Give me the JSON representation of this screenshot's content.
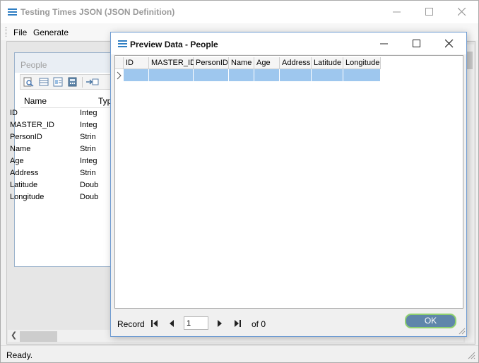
{
  "main_window": {
    "title": "Testing Times JSON (JSON Definition)",
    "menu": [
      "File",
      "Generate"
    ],
    "status": "Ready."
  },
  "people_panel": {
    "title": "People",
    "columns": [
      "Name",
      "Typ"
    ],
    "fields": [
      {
        "name": "ID",
        "type": "Integ"
      },
      {
        "name": "MASTER_ID",
        "type": "Integ"
      },
      {
        "name": "PersonID",
        "type": "Strin"
      },
      {
        "name": "Name",
        "type": "Strin"
      },
      {
        "name": "Age",
        "type": "Integ"
      },
      {
        "name": "Address",
        "type": "Strin"
      },
      {
        "name": "Latitude",
        "type": "Doub"
      },
      {
        "name": "Longitude",
        "type": "Doub"
      }
    ]
  },
  "dialog": {
    "title": "Preview Data - People",
    "grid_columns": [
      "ID",
      "MASTER_ID",
      "PersonID",
      "Name",
      "Age",
      "Address",
      "Latitude",
      "Longitude"
    ],
    "navigator": {
      "record_label": "Record",
      "record_value": "1",
      "of_label": "of 0"
    },
    "ok_label": "OK"
  },
  "colors": {
    "accent": "#2f7ec3",
    "selected_row": "#9ec7ee",
    "ok_button": "#5f86aa",
    "ok_border": "#8fd06f"
  }
}
